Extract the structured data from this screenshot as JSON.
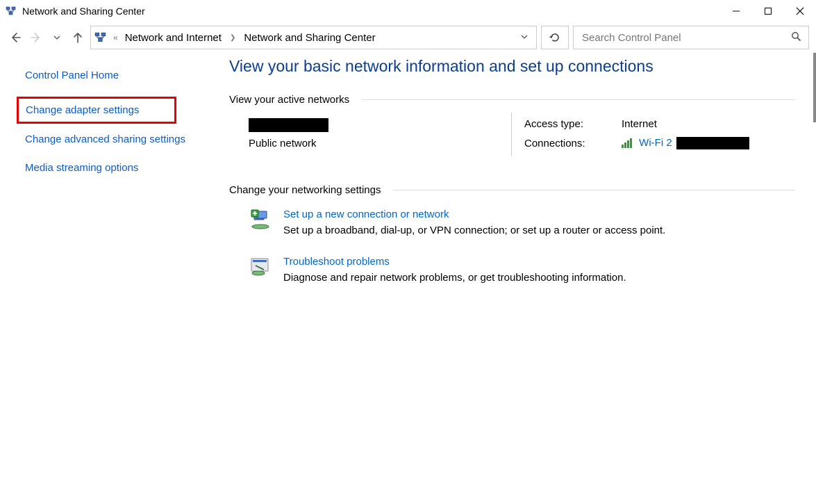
{
  "window": {
    "title": "Network and Sharing Center"
  },
  "breadcrumbs": {
    "item0": "Network and Internet",
    "item1": "Network and Sharing Center"
  },
  "search": {
    "placeholder": "Search Control Panel"
  },
  "sidebar": {
    "home": "Control Panel Home",
    "adapter": "Change adapter settings",
    "advanced": "Change advanced sharing settings",
    "media": "Media streaming options"
  },
  "main": {
    "title": "View your basic network information and set up connections",
    "active_header": "View your active networks",
    "network_type": "Public network",
    "access_label": "Access type:",
    "access_value": "Internet",
    "connections_label": "Connections:",
    "connection_name": "Wi-Fi 2",
    "change_header": "Change your networking settings",
    "task1_title": "Set up a new connection or network",
    "task1_desc": "Set up a broadband, dial-up, or VPN connection; or set up a router or access point.",
    "task2_title": "Troubleshoot problems",
    "task2_desc": "Diagnose and repair network problems, or get troubleshooting information."
  }
}
